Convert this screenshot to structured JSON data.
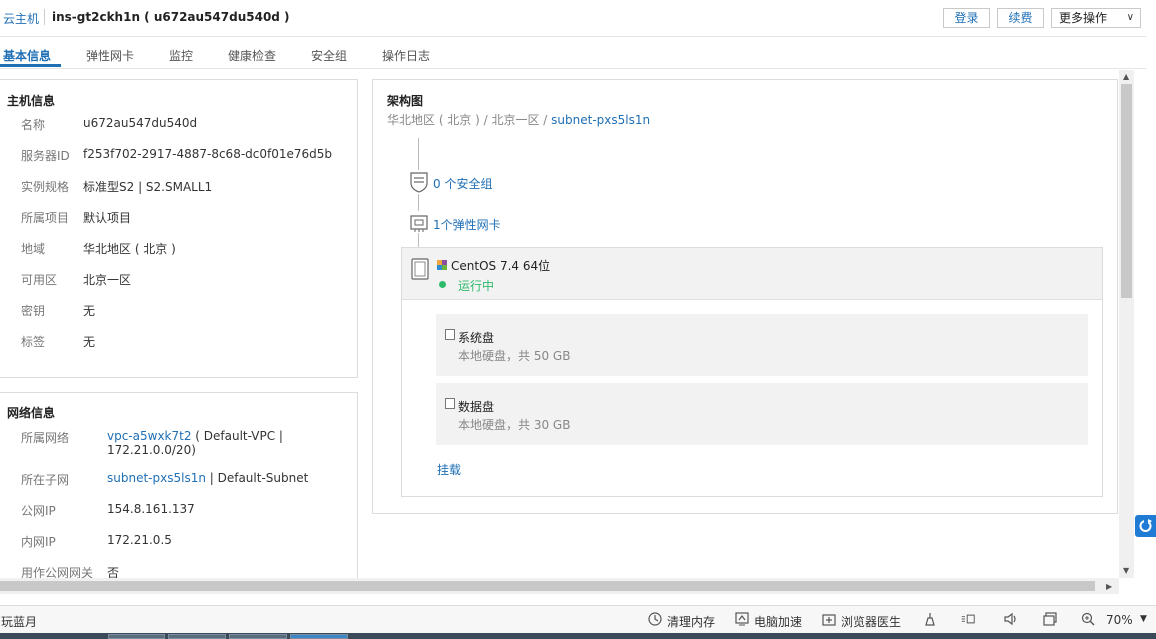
{
  "header": {
    "breadcrumb": "云主机",
    "title": "ins-gt2ckh1n ( u672au547du540d )",
    "btn_login": "登录",
    "btn_renew": "续费",
    "btn_more": "更多操作"
  },
  "tabs": [
    "基本信息",
    "弹性网卡",
    "监控",
    "健康检查",
    "安全组",
    "操作日志"
  ],
  "host_info": {
    "title": "主机信息",
    "rows": [
      {
        "label": "名称",
        "value": "u672au547du540d"
      },
      {
        "label": "服务器ID",
        "value": "f253f702-2917-4887-8c68-dc0f01e76d5b"
      },
      {
        "label": "实例规格",
        "value": "标准型S2 | S2.SMALL1"
      },
      {
        "label": "所属项目",
        "value": "默认项目"
      },
      {
        "label": "地域",
        "value": "华北地区 ( 北京 )"
      },
      {
        "label": "可用区",
        "value": "北京一区"
      },
      {
        "label": "密钥",
        "value": "无"
      },
      {
        "label": "标签",
        "value": "无"
      }
    ]
  },
  "network_info": {
    "title": "网络信息",
    "vpc_label": "所属网络",
    "vpc_link": "vpc-a5wxk7t2",
    "vpc_rest_1": " ( Default-VPC |",
    "vpc_rest_2": "172.21.0.0/20)",
    "subnet_label": "所在子网",
    "subnet_link": "subnet-pxs5ls1n",
    "subnet_rest": " | Default-Subnet",
    "public_ip_label": "公网IP",
    "public_ip": "154.8.161.137",
    "private_ip_label": "内网IP",
    "private_ip": "172.21.0.5",
    "gateway_label": "用作公网网关",
    "gateway": "否"
  },
  "arch": {
    "title": "架构图",
    "path_prefix": "华北地区 ( 北京 ) / 北京一区 / ",
    "path_subnet": "subnet-pxs5ls1n",
    "security_groups": "0 个安全组",
    "nics": "1个弹性网卡",
    "os": "CentOS 7.4 64位",
    "status": "运行中",
    "status_color": "#2dbb6b",
    "disks": [
      {
        "name": "系统盘",
        "desc": "本地硬盘，共 50 GB"
      },
      {
        "name": "数据盘",
        "desc": "本地硬盘，共 30 GB"
      }
    ],
    "mount": "挂载"
  },
  "statusbar": {
    "left": "玩蓝月",
    "clear_mem": "清理内存",
    "speedup": "电脑加速",
    "browser_doctor": "浏览器医生",
    "zoom": "70%"
  }
}
